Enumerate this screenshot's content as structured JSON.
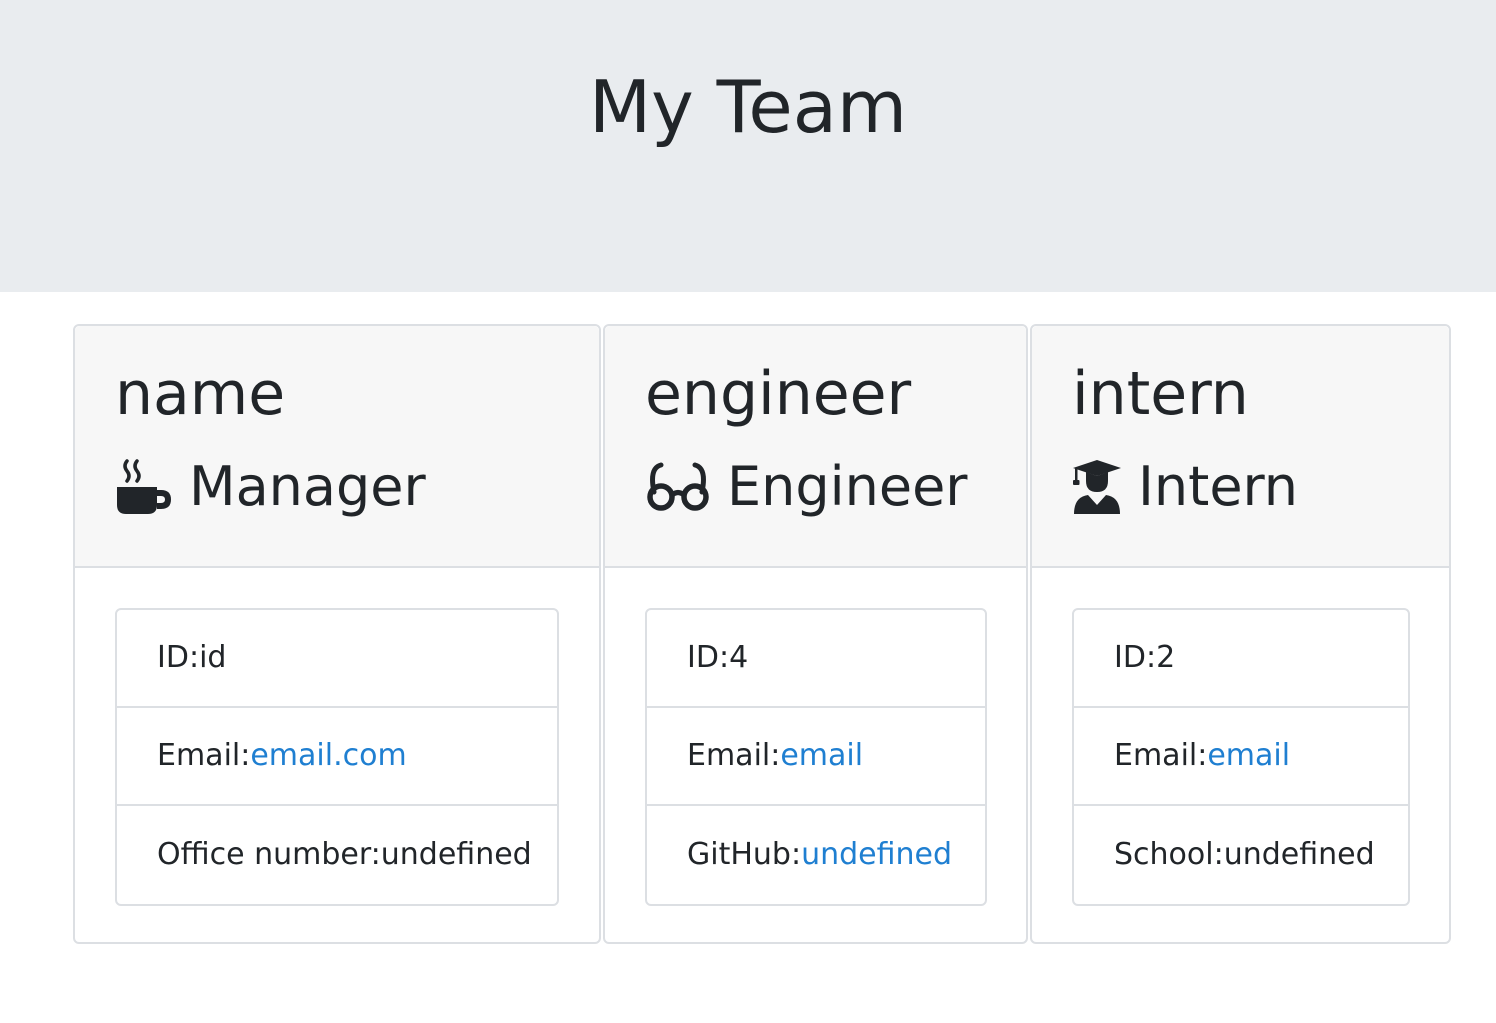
{
  "header": {
    "title": "My Team"
  },
  "cards": [
    {
      "name": "name",
      "role": "Manager",
      "icon": "mug-icon",
      "items": [
        {
          "label": "ID: ",
          "value": "id"
        },
        {
          "label": "Email: ",
          "value": "email.com"
        },
        {
          "label": "Office number: ",
          "value": "undefined"
        }
      ]
    },
    {
      "name": "engineer",
      "role": "Engineer",
      "icon": "glasses-icon",
      "items": [
        {
          "label": "ID: ",
          "value": "4"
        },
        {
          "label": "Email: ",
          "value": "email"
        },
        {
          "label": "GitHub: ",
          "value": "undefined"
        }
      ]
    },
    {
      "name": "intern",
      "role": "Intern",
      "icon": "graduate-icon",
      "items": [
        {
          "label": "ID: ",
          "value": "2"
        },
        {
          "label": "Email: ",
          "value": "email"
        },
        {
          "label": "School: ",
          "value": "undefined"
        }
      ]
    }
  ],
  "colors": {
    "link": "#1f7fd1",
    "header_bg": "#e9ecef",
    "card_header_bg": "#f7f7f7",
    "border": "#dcdfe3"
  }
}
